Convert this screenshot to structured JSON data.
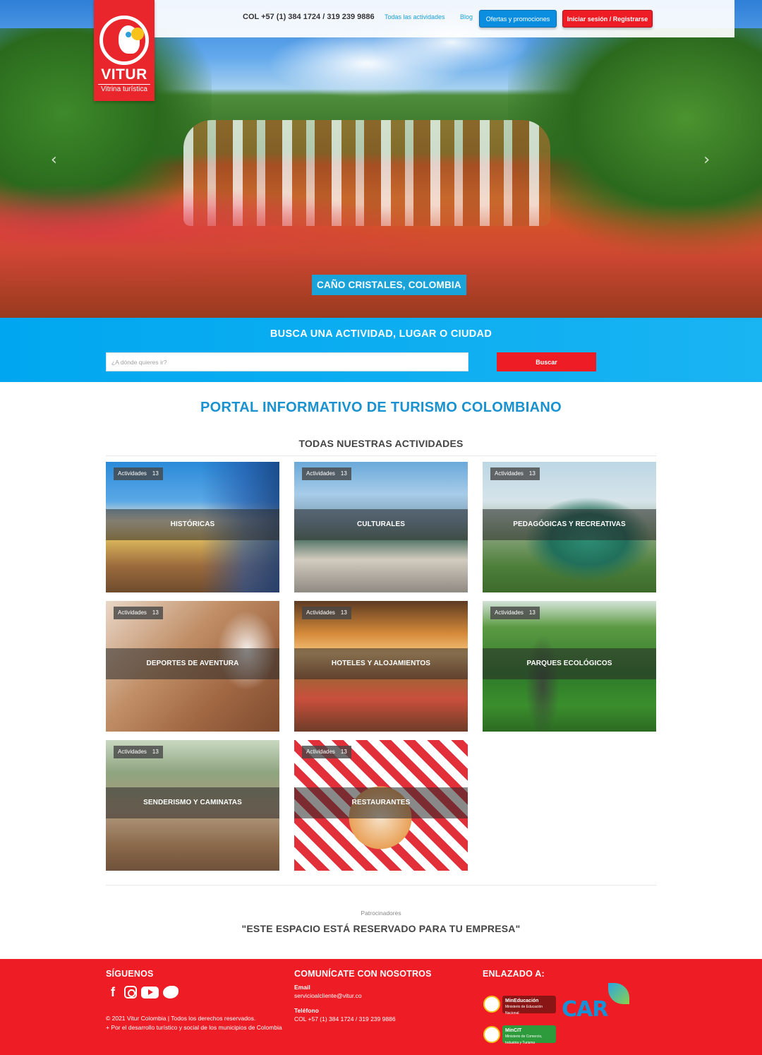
{
  "header": {
    "brand": "VITUR",
    "tagline": "Vitrina turística",
    "phone": "COL +57 (1) 384 1724 / 319 239 9886",
    "nav": {
      "all_activities": "Todas las actividades",
      "blog": "Blog",
      "offers": "Ofertas y promociones",
      "login": "Iniciar sesión / Registrarse"
    }
  },
  "hero": {
    "caption": "CAÑO CRISTALES, COLOMBIA",
    "prev_icon": "chevron-left-icon",
    "next_icon": "chevron-right-icon"
  },
  "search": {
    "title": "BUSCA UNA ACTIVIDAD, LUGAR O CIUDAD",
    "placeholder": "¿A dónde quieres ir?",
    "button": "Buscar"
  },
  "main": {
    "portal_title": "PORTAL INFORMATIVO DE TURISMO COLOMBIANO",
    "activities_title": "TODAS NUESTRAS ACTIVIDADES",
    "badge_label": "Actividades",
    "categories": [
      {
        "label": "HISTÓRICAS",
        "count": "13"
      },
      {
        "label": "CULTURALES",
        "count": "13"
      },
      {
        "label": "PEDAGÓGICAS Y RECREATIVAS",
        "count": "13"
      },
      {
        "label": "DEPORTES DE AVENTURA",
        "count": "13"
      },
      {
        "label": "HOTELES Y ALOJAMIENTOS",
        "count": "13"
      },
      {
        "label": "PARQUES ECOLÓGICOS",
        "count": "13"
      },
      {
        "label": "SENDERISMO Y CAMINATAS",
        "count": "13"
      },
      {
        "label": "RESTAURANTES",
        "count": "13"
      }
    ]
  },
  "sponsors": {
    "label": "Patrocinadores",
    "text": "\"ESTE ESPACIO ESTÁ RESERVADO PARA TU EMPRESA\""
  },
  "footer": {
    "follow_title": "SÍGUENOS",
    "social": [
      "facebook-icon",
      "instagram-icon",
      "youtube-icon",
      "twitter-icon"
    ],
    "copyright_line1": "© 2021 Vitur Colombia | Todos los derechos reservados.",
    "copyright_line2": "+ Por el desarrollo turístico y social de los municipios de Colombia",
    "contact_title": "COMUNÍCATE CON NOSOTROS",
    "email_label": "Email",
    "email": "servicioalcliente@vitur.co",
    "phone_label": "Teléfono",
    "phone": "COL +57 (1) 384 1724 / 319 239 9886",
    "linked_title": "ENLAZADO A:",
    "partners": {
      "mineducacion": "MinEducación",
      "mineducacion_sub": "Ministerio de Educación Nacional",
      "mincit": "MinCIT",
      "mincit_sub": "Ministerio de Comercio, Industria y Turismo",
      "car": "CAR"
    }
  },
  "colors": {
    "brand_red": "#ee1c25",
    "accent_blue": "#1a92cf",
    "search_band": "#00a7f0"
  }
}
